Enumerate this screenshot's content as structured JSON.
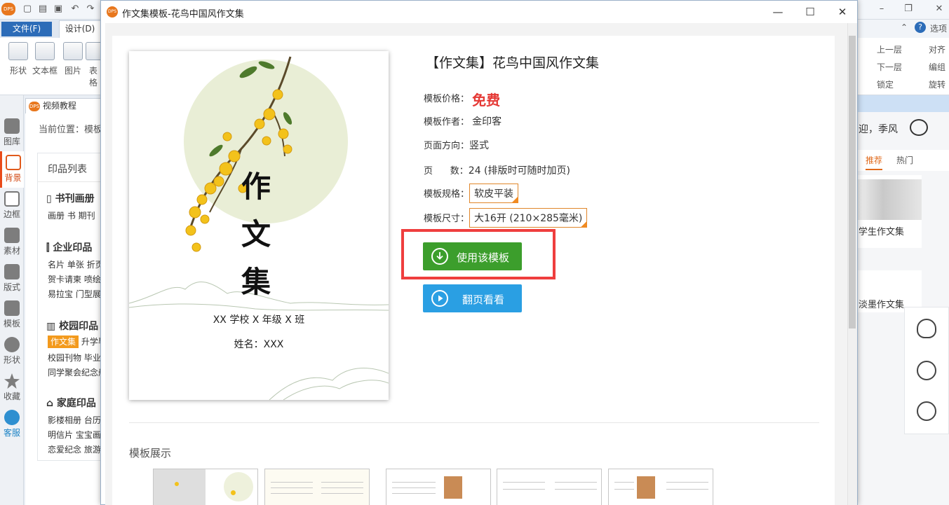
{
  "background_app": {
    "ribbon_tabs": {
      "file": "文件(F)",
      "design": "设计(D)"
    },
    "ribbon_tools": [
      "形状",
      "文本框",
      "图片",
      "表格"
    ],
    "left_rail": [
      "图库",
      "背景",
      "边框",
      "素材",
      "版式",
      "模板",
      "形状",
      "收藏",
      "客服"
    ],
    "doc_tab": "视频教程",
    "breadcrumb": "当前位置：模板",
    "print_list": {
      "title": "印品列表",
      "sections": [
        {
          "name": "书刊画册",
          "rows": [
            "画册  书  期刊"
          ]
        },
        {
          "name": "企业印品",
          "rows": [
            "名片  单张  折页",
            "贺卡请柬  喷绘",
            "易拉宝  门型展架"
          ]
        },
        {
          "name": "校园印品",
          "rows": [
            "作文集",
            "升学毕业",
            "校园刊物  毕业",
            "同学聚会纪念册"
          ]
        },
        {
          "name": "家庭印品",
          "rows": [
            "影楼相册  台历",
            "明信片  宝宝画册",
            "恋爱纪念  旅游"
          ]
        }
      ]
    },
    "right_panel": {
      "options": "选项",
      "tools": [
        "上一层",
        "对齐",
        "下一层",
        "编组",
        "锁定",
        "旋转"
      ],
      "welcome": "迎，季风",
      "tabs": [
        "推荐",
        "热门"
      ],
      "cards": [
        "学生作文集",
        "淡墨作文集"
      ]
    }
  },
  "dialog": {
    "title": "作文集模板-花鸟中国风作文集",
    "cover": {
      "chars": [
        "作",
        "文",
        "集"
      ],
      "school": "XX 学校 X 年级 X 班",
      "name": "姓名：XXX"
    },
    "template_title": "【作文集】花鸟中国风作文集",
    "info": {
      "price_label": "模板价格：",
      "price_value": "免费",
      "author_label": "模板作者：",
      "author_value": "金印客",
      "orientation_label": "页面方向：",
      "orientation_value": "竖式",
      "pages_label": "页      数：",
      "pages_value": "24 (排版时可随时加页)",
      "spec_label": "模板规格：",
      "spec_value": "软皮平装",
      "size_label": "模板尺寸：",
      "size_value": "大16开 (210×285毫米)"
    },
    "use_button": "使用该模板",
    "flip_button": "翻页看看",
    "showcase_title": "模板展示"
  },
  "colors": {
    "accent_green": "#3c9e2c",
    "accent_blue": "#2a9fe3",
    "price_red": "#e53935",
    "highlight_red": "#ef3e3e"
  }
}
